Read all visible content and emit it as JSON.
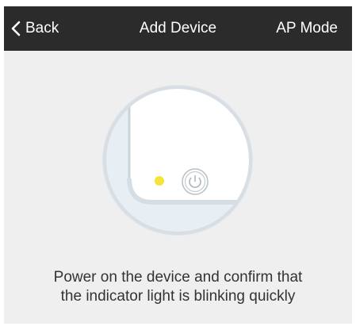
{
  "navbar": {
    "back_label": "Back",
    "title": "Add Device",
    "mode_label": "AP Mode"
  },
  "illustration": {
    "indicator_color": "#f5e43a",
    "icons": [
      "device-illustration",
      "indicator-light-icon",
      "power-button-icon"
    ]
  },
  "instruction": {
    "line1": "Power on the device and confirm that",
    "line2": "the indicator light is blinking quickly"
  },
  "colors": {
    "navbar_bg": "#2b2b2b",
    "page_bg": "#efefef",
    "text": "#333333"
  }
}
